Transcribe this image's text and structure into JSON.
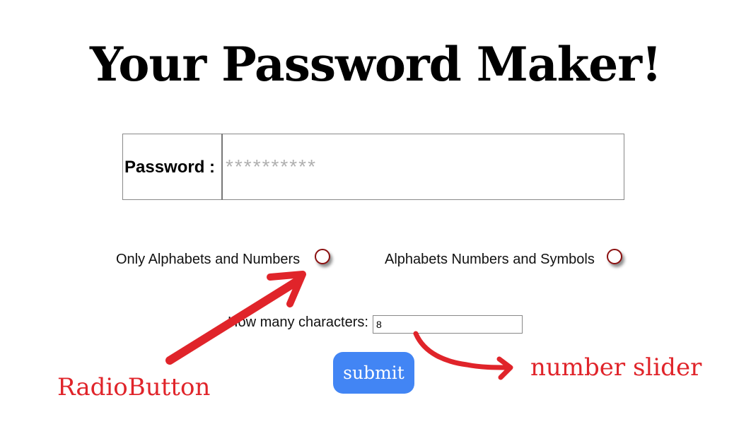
{
  "page": {
    "title": "Your Password Maker!"
  },
  "password": {
    "label": "Password :",
    "placeholder": "**********"
  },
  "options": [
    {
      "label": "Only Alphabets and Numbers",
      "selected": false
    },
    {
      "label": "Alphabets Numbers and Symbols",
      "selected": false
    }
  ],
  "length": {
    "label": "How many characters:",
    "value": "8"
  },
  "submit": {
    "label": "submit"
  },
  "annotations": {
    "radio": "RadioButton",
    "slider": "number slider",
    "color": "#e0242a"
  },
  "colors": {
    "button": "#4285f4",
    "radio_border": "#8b1010"
  }
}
